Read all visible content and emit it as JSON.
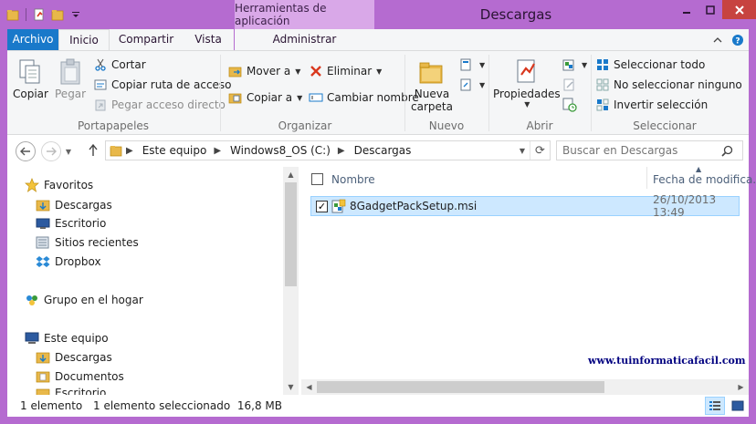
{
  "window": {
    "title": "Descargas",
    "context_tab_title": "Herramientas de aplicación",
    "colors": {
      "frame": "#b56bd0",
      "context_tab": "#d9a8e8",
      "file_tab": "#1979ca",
      "close": "#c74340",
      "selection": "#cde8ff"
    }
  },
  "ribbon_tabs": {
    "archivo": "Archivo",
    "inicio": "Inicio",
    "compartir": "Compartir",
    "vista": "Vista",
    "administrar": "Administrar"
  },
  "ribbon": {
    "portapapeles": {
      "label": "Portapapeles",
      "copiar": "Copiar",
      "pegar": "Pegar",
      "cortar": "Cortar",
      "copiar_ruta": "Copiar ruta de acceso",
      "pegar_acceso": "Pegar acceso directo"
    },
    "organizar": {
      "label": "Organizar",
      "mover_a": "Mover a",
      "copiar_a": "Copiar a",
      "eliminar": "Eliminar",
      "cambiar_nombre": "Cambiar nombre"
    },
    "nuevo": {
      "label": "Nuevo",
      "nueva_carpeta_1": "Nueva",
      "nueva_carpeta_2": "carpeta"
    },
    "abrir": {
      "label": "Abrir",
      "propiedades": "Propiedades"
    },
    "seleccionar": {
      "label": "Seleccionar",
      "todo": "Seleccionar todo",
      "ninguno": "No seleccionar ninguno",
      "invertir": "Invertir selección"
    }
  },
  "address": {
    "crumbs": [
      "Este equipo",
      "Windows8_OS (C:)",
      "Descargas"
    ],
    "search_placeholder": "Buscar en Descargas"
  },
  "nav_pane": {
    "favoritos": "Favoritos",
    "descargas": "Descargas",
    "escritorio": "Escritorio",
    "sitios_recientes": "Sitios recientes",
    "dropbox": "Dropbox",
    "grupo_hogar": "Grupo en el hogar",
    "este_equipo": "Este equipo",
    "descargas2": "Descargas",
    "documentos": "Documentos",
    "escritorio2": "Escritorio"
  },
  "file_list": {
    "col_name": "Nombre",
    "col_date": "Fecha de modifica...",
    "files": [
      {
        "name": "8GadgetPackSetup.msi",
        "date": "26/10/2013 13:49",
        "selected": true
      }
    ]
  },
  "watermark": "www.tuinformaticafacil.com",
  "status": {
    "count": "1 elemento",
    "selection": "1 elemento seleccionado  16,8 MB"
  }
}
